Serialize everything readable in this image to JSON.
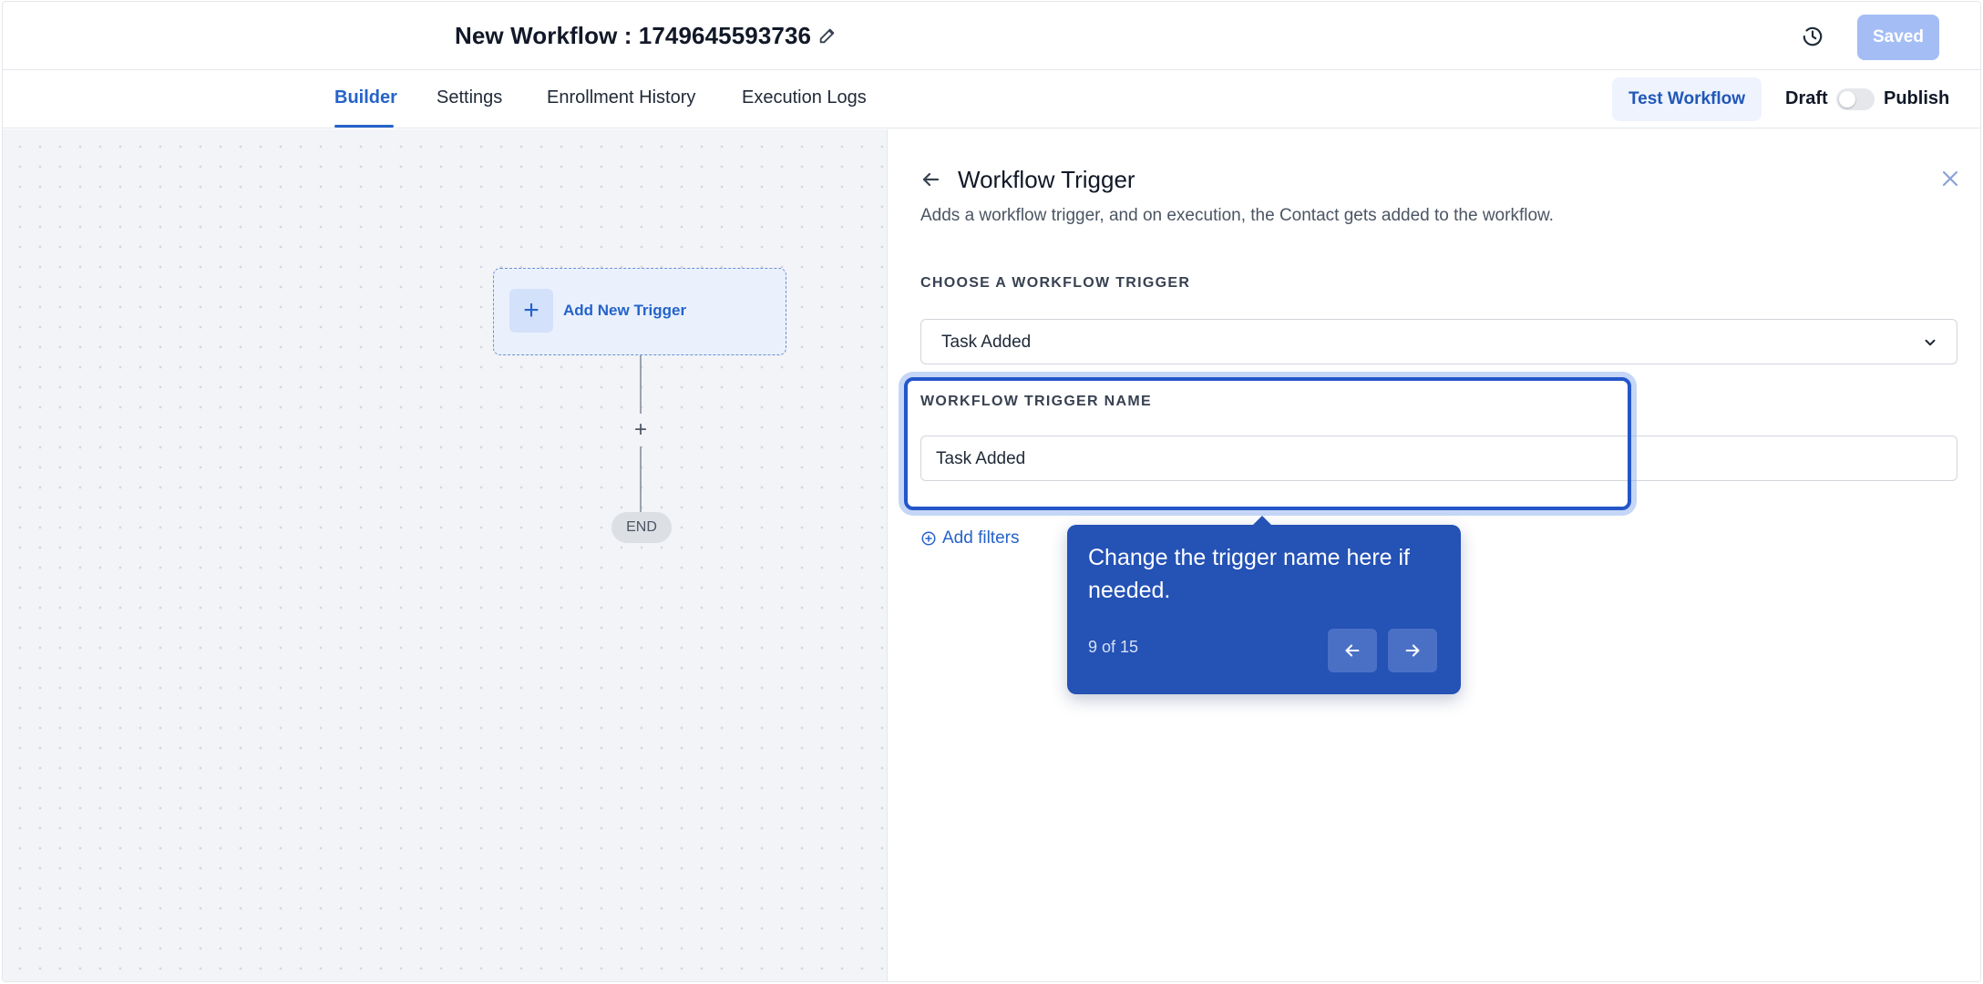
{
  "header": {
    "title": "New Workflow : 1749645593736",
    "saved_label": "Saved"
  },
  "nav": {
    "tabs": [
      {
        "label": "Builder",
        "active": true
      },
      {
        "label": "Settings",
        "active": false
      },
      {
        "label": "Enrollment History",
        "active": false
      },
      {
        "label": "Execution Logs",
        "active": false
      }
    ],
    "test_workflow_label": "Test Workflow",
    "draft_label": "Draft",
    "publish_label": "Publish",
    "publish_enabled": false
  },
  "canvas": {
    "add_trigger_label": "Add New Trigger",
    "end_label": "END"
  },
  "panel": {
    "title": "Workflow Trigger",
    "subtitle": "Adds a workflow trigger, and on execution, the Contact gets added to the workflow.",
    "trigger_section_label": "CHOOSE A WORKFLOW TRIGGER",
    "trigger_value": "Task Added",
    "name_section_label": "WORKFLOW TRIGGER NAME",
    "name_value": "Task Added",
    "add_filters_label": "Add filters"
  },
  "tour": {
    "message": "Change the trigger name here if needed.",
    "step_text": "9 of 15"
  },
  "colors": {
    "accent": "#2563c9",
    "tooltip_bg": "#2452b5",
    "saved_bg": "#a5bdf5"
  }
}
